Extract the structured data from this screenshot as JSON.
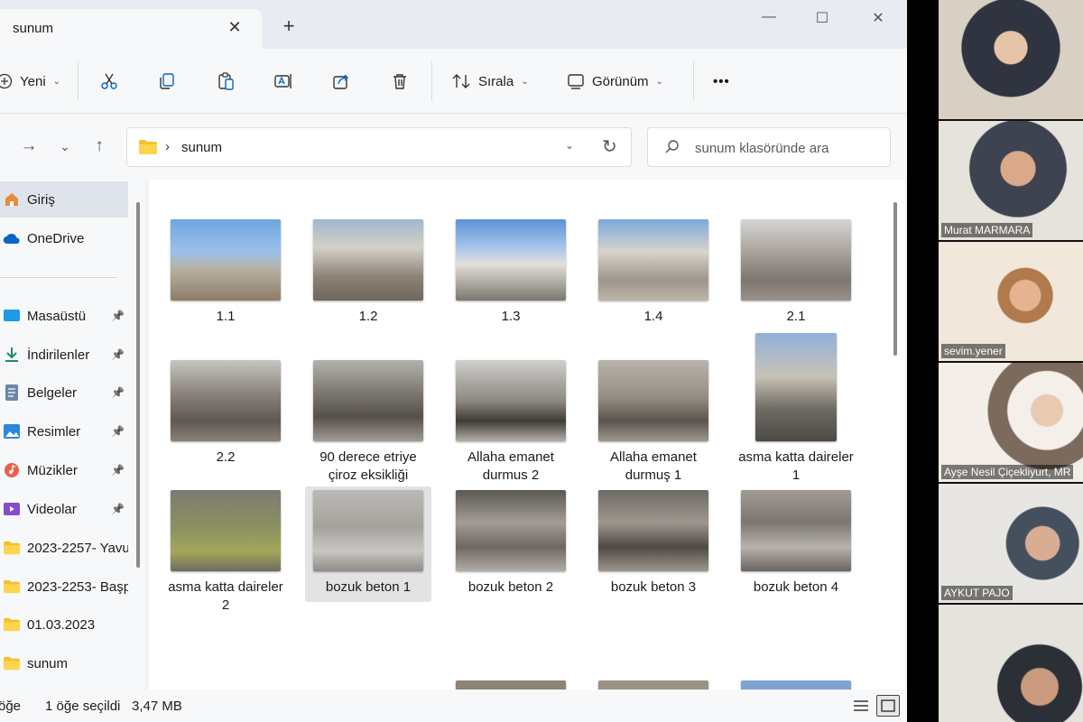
{
  "window": {
    "tab_title": "sunum",
    "new_tab": "+",
    "minimize": "—",
    "maximize": "☐",
    "close": "✕"
  },
  "toolbar": {
    "new_label": "Yeni",
    "sort_label": "Sırala",
    "view_label": "Görünüm",
    "more_label": "•••"
  },
  "address": {
    "current_folder": "sunum",
    "search_placeholder": "sunum klasöründe ara"
  },
  "sidebar": {
    "items": [
      {
        "label": "Giriş",
        "icon": "home-icon",
        "selected": true,
        "pinned": false
      },
      {
        "label": "OneDrive",
        "icon": "cloud-icon",
        "selected": false,
        "pinned": false
      },
      {
        "label": "Masaüstü",
        "icon": "desktop-icon",
        "selected": false,
        "pinned": true
      },
      {
        "label": "İndirilenler",
        "icon": "download-icon",
        "selected": false,
        "pinned": true
      },
      {
        "label": "Belgeler",
        "icon": "document-icon",
        "selected": false,
        "pinned": true
      },
      {
        "label": "Resimler",
        "icon": "pictures-icon",
        "selected": false,
        "pinned": true
      },
      {
        "label": "Müzikler",
        "icon": "music-icon",
        "selected": false,
        "pinned": true
      },
      {
        "label": "Videolar",
        "icon": "video-icon",
        "selected": false,
        "pinned": true
      },
      {
        "label": "2023-2257- Yavu",
        "icon": "folder-icon",
        "selected": false,
        "pinned": false
      },
      {
        "label": "2023-2253- Başp",
        "icon": "folder-icon",
        "selected": false,
        "pinned": false
      },
      {
        "label": "01.03.2023",
        "icon": "folder-icon",
        "selected": false,
        "pinned": false
      },
      {
        "label": "sunum",
        "icon": "folder-icon",
        "selected": false,
        "pinned": false
      }
    ]
  },
  "files": [
    {
      "name": "1.1",
      "selected": false
    },
    {
      "name": "1.2",
      "selected": false
    },
    {
      "name": "1.3",
      "selected": false
    },
    {
      "name": "1.4",
      "selected": false
    },
    {
      "name": "2.1",
      "selected": false
    },
    {
      "name": "2.2",
      "selected": false
    },
    {
      "name": "90 derece etriye çiroz eksikliği",
      "selected": false
    },
    {
      "name": "Allaha emanet durmus 2",
      "selected": false
    },
    {
      "name": "Allaha emanet durmuş 1",
      "selected": false
    },
    {
      "name": "asma katta daireler 1",
      "selected": false
    },
    {
      "name": "asma katta daireler 2",
      "selected": false
    },
    {
      "name": "bozuk beton 1",
      "selected": true
    },
    {
      "name": "bozuk beton 2",
      "selected": false
    },
    {
      "name": "bozuk beton 3",
      "selected": false
    },
    {
      "name": "bozuk beton 4",
      "selected": false
    }
  ],
  "status": {
    "count_fragment": "öğe",
    "selection": "1 öğe seçildi",
    "size": "3,47 MB"
  },
  "participants": [
    {
      "name": ""
    },
    {
      "name": "Murat MARMARA"
    },
    {
      "name": "sevim.yener"
    },
    {
      "name": "Ayşe Nesil Çiçekliyurt, MR"
    },
    {
      "name": "AYKUT PAJO"
    },
    {
      "name": ""
    }
  ],
  "colors": {
    "accent": "#0067c0",
    "folder": "#f3c12e",
    "window_bg": "#f3f3f3"
  }
}
